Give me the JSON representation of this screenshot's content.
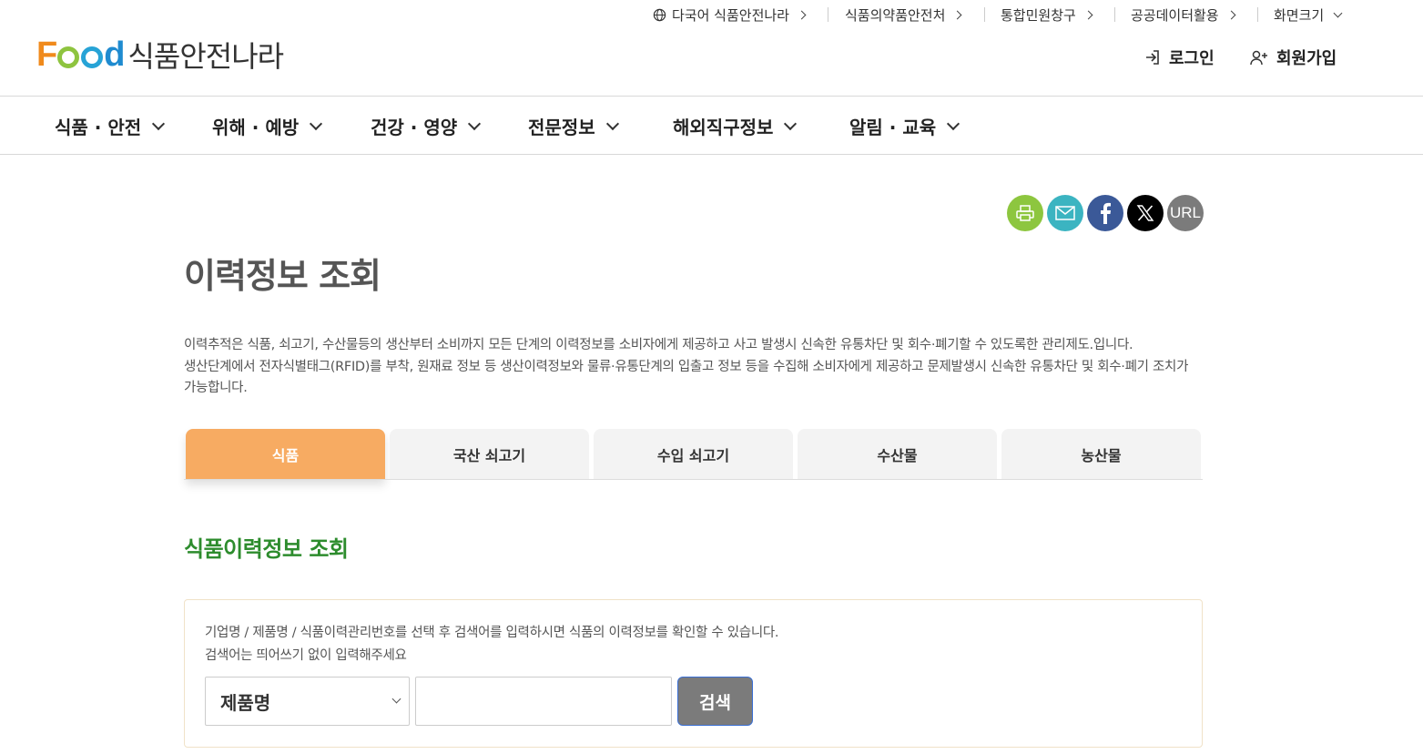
{
  "utility": {
    "multilang": "다국어 식품안전나라",
    "mfds": "식품의약품안전처",
    "civil": "통합민원창구",
    "opendata": "공공데이터활용",
    "fontsize": "화면크기"
  },
  "logo": {
    "en": "Food",
    "kr": "식품안전나라"
  },
  "auth": {
    "login": "로그인",
    "join": "회원가입"
  },
  "gnb": [
    "식품 · 안전",
    "위해 · 예방",
    "건강 · 영양",
    "전문정보",
    "해외직구정보",
    "알림 · 교육"
  ],
  "share": {
    "print": "print-icon",
    "mail": "mail-icon",
    "facebook": "facebook-icon",
    "x": "x-icon",
    "url": "URL"
  },
  "page": {
    "title": "이력정보 조회",
    "desc1": "이력추적은 식품, 쇠고기, 수산물등의 생산부터 소비까지 모든 단계의 이력정보를 소비자에게 제공하고 사고 발생시 신속한 유통차단 및 회수·폐기할 수 있도록한 관리제도.입니다.",
    "desc2": "생산단계에서 전자식별태그(RFID)를 부착, 원재료 정보 등 생산이력정보와 물류·유통단계의 입출고 정보 등을 수집해 소비자에게 제공하고 문제발생시 신속한 유통차단 및 회수·폐기 조치가 가능합니다."
  },
  "tabs": [
    "식품",
    "국산 쇠고기",
    "수입 쇠고기",
    "수산물",
    "농산물"
  ],
  "active_tab": 0,
  "section": {
    "title": "식품이력정보 조회"
  },
  "search": {
    "help1": "기업명 / 제품명 / 식품이력관리번호를 선택 후 검색어를 입력하시면 식품의 이력정보를 확인할 수 있습니다.",
    "help2": "검색어는 띄어쓰기 없이 입력해주세요",
    "select_value": "제품명",
    "input_value": "",
    "button": "검색"
  },
  "colors": {
    "active_tab": "#f7ab62",
    "section_title": "#2d8c2d",
    "search_button": "#7b7b7b"
  }
}
